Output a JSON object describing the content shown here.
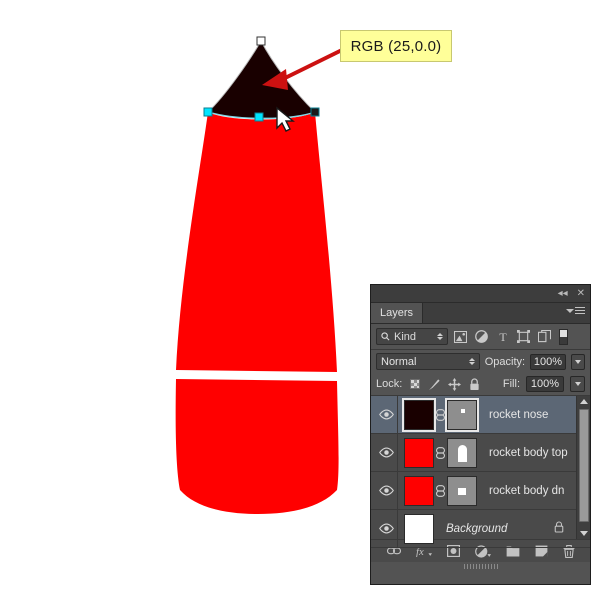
{
  "callout": {
    "text": "RGB (25,0.0)",
    "bg": "#ffff99",
    "border": "#c8c870"
  },
  "artwork": {
    "nose_color": "#190000",
    "body_color": "#ff0000",
    "background": "#ffffff",
    "anchor_color": "#00e5ff",
    "path_color": "#7fd8e8",
    "arrow_color": "#cc1111"
  },
  "panel": {
    "titlebar": {
      "collapse_icon": "collapse-double-arrow",
      "close_icon": "close-x"
    },
    "tab": {
      "label": "Layers",
      "menu_icon": "panel-menu"
    },
    "filter": {
      "kind_label": "Kind",
      "search_icon": "search-icon",
      "icons": [
        "image-filter-icon",
        "adjustment-filter-icon",
        "type-filter-icon",
        "shape-filter-icon",
        "smart-object-filter-icon"
      ],
      "toggle": "filter-toggle"
    },
    "blend": {
      "mode": "Normal",
      "opacity_label": "Opacity:",
      "opacity_value": "100%",
      "fill_label": "Fill:",
      "fill_value": "100%"
    },
    "lock": {
      "label": "Lock:",
      "icons": [
        "lock-transparent-pixels-icon",
        "lock-image-pixels-icon",
        "lock-position-icon",
        "lock-all-icon"
      ]
    },
    "layers": [
      {
        "name": "rocket nose",
        "thumb_color": "#190000",
        "has_mask": true,
        "mask_shape": "dot",
        "selected": true,
        "visible": true,
        "locked": false,
        "italic": false
      },
      {
        "name": "rocket body top",
        "thumb_color": "#ff0000",
        "has_mask": true,
        "mask_shape": "dome",
        "selected": false,
        "visible": true,
        "locked": false,
        "italic": false
      },
      {
        "name": "rocket body dn",
        "thumb_color": "#ff0000",
        "has_mask": true,
        "mask_shape": "square",
        "selected": false,
        "visible": true,
        "locked": false,
        "italic": false
      },
      {
        "name": "Background",
        "thumb_color": "#ffffff",
        "has_mask": false,
        "mask_shape": "",
        "selected": false,
        "visible": true,
        "locked": true,
        "italic": true
      }
    ],
    "scrollbar": {
      "up": "scroll-up-arrow",
      "down": "scroll-down-arrow"
    },
    "bottom_icons": [
      "link-layers-icon",
      "layer-style-fx-icon",
      "add-mask-icon",
      "adjustment-layer-icon",
      "new-group-icon",
      "new-layer-icon",
      "delete-layer-icon"
    ]
  }
}
